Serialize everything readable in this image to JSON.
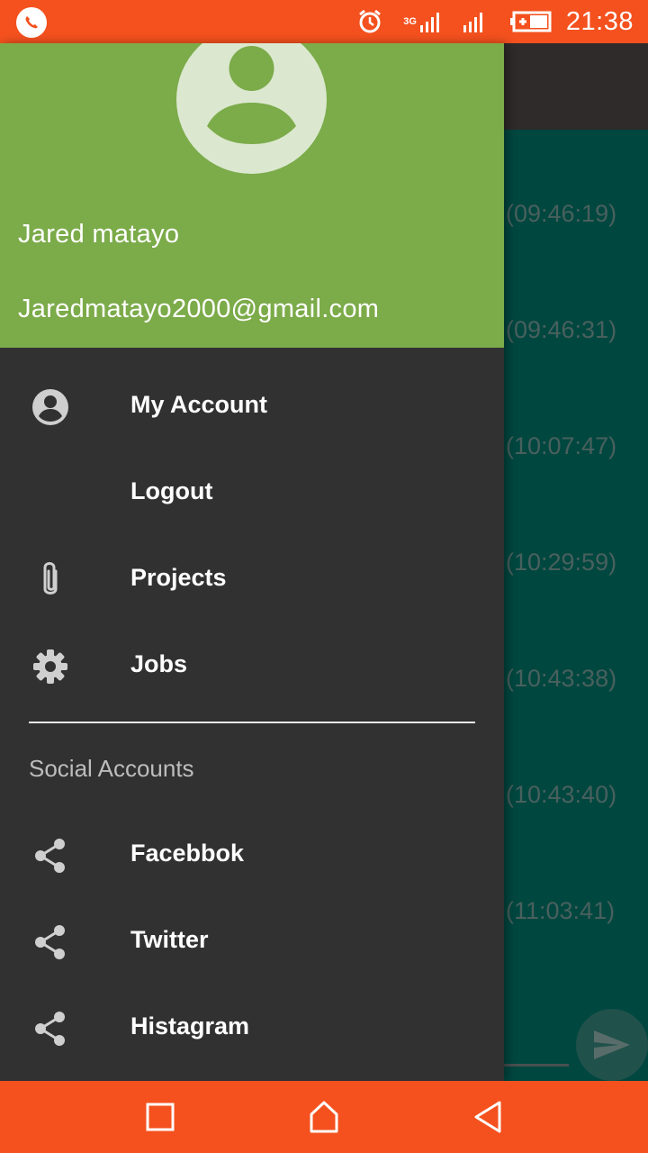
{
  "status_bar": {
    "time": "21:38",
    "network": "3G",
    "icons": [
      "whatsapp-icon",
      "alarm-icon",
      "signal-icon",
      "signal-icon",
      "battery-icon"
    ]
  },
  "background_chat": {
    "timestamps": [
      "(09:46:19)",
      "(09:46:31)",
      "(10:07:47)",
      "(10:29:59)",
      "(10:43:38)",
      "(10:43:40)",
      "(11:03:41)"
    ],
    "send_icon": "send-icon"
  },
  "drawer": {
    "header": {
      "name": "Jared matayo",
      "email": "Jaredmatayo2000@gmail.com",
      "avatar_icon": "account-circle-icon"
    },
    "items": [
      {
        "label": "My Account",
        "icon": "account-circle-icon"
      },
      {
        "label": "Logout",
        "icon": ""
      },
      {
        "label": "Projects",
        "icon": "paperclip-icon"
      },
      {
        "label": "Jobs",
        "icon": "gear-icon"
      }
    ],
    "section_title": "Social Accounts",
    "social_items": [
      {
        "label": "Facebbok",
        "icon": "share-icon"
      },
      {
        "label": "Twitter",
        "icon": "share-icon"
      },
      {
        "label": "Histagram",
        "icon": "share-icon"
      }
    ]
  },
  "nav_bar": {
    "buttons": [
      "recents-icon",
      "home-icon",
      "back-icon"
    ]
  },
  "colors": {
    "system_bar": "#f4511e",
    "drawer_header": "#7cab4a",
    "drawer_bg": "#313131",
    "chat_bg": "#00897b"
  }
}
